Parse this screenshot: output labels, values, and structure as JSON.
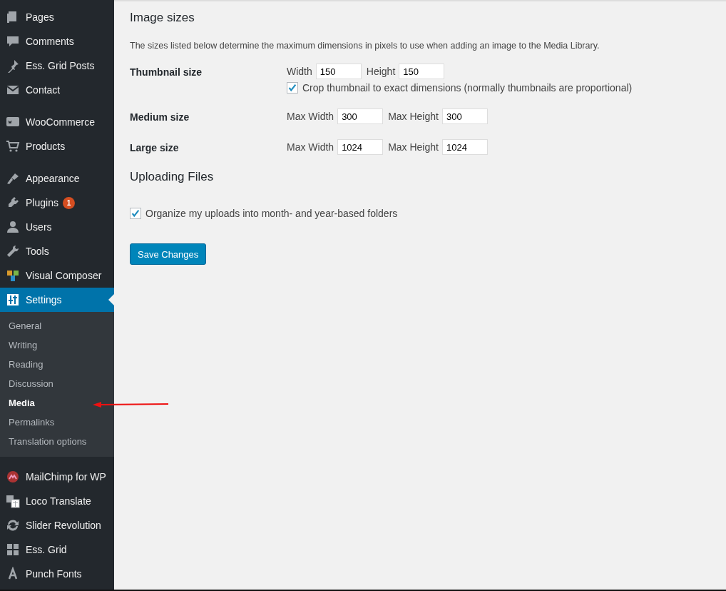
{
  "sidebar": {
    "groups": [
      {
        "items": [
          {
            "label": "Pages",
            "selected": false
          },
          {
            "label": "Comments",
            "selected": false
          },
          {
            "label": "Ess. Grid Posts",
            "selected": false
          },
          {
            "label": "Contact",
            "selected": false
          }
        ]
      },
      {
        "items": [
          {
            "label": "WooCommerce",
            "selected": false
          },
          {
            "label": "Products",
            "selected": false
          }
        ]
      },
      {
        "items": [
          {
            "label": "Appearance",
            "selected": false
          },
          {
            "label": "Plugins",
            "selected": false,
            "badge": "1"
          },
          {
            "label": "Users",
            "selected": false
          },
          {
            "label": "Tools",
            "selected": false
          },
          {
            "label": "Visual Composer",
            "selected": false
          },
          {
            "label": "Settings",
            "selected": true,
            "submenu": [
              {
                "label": "General",
                "selected": false
              },
              {
                "label": "Writing",
                "selected": false
              },
              {
                "label": "Reading",
                "selected": false
              },
              {
                "label": "Discussion",
                "selected": false
              },
              {
                "label": "Media",
                "selected": true
              },
              {
                "label": "Permalinks",
                "selected": false
              },
              {
                "label": "Translation options",
                "selected": false
              }
            ]
          }
        ]
      },
      {
        "items": [
          {
            "label": "MailChimp for WP",
            "selected": false
          },
          {
            "label": "Loco Translate",
            "selected": false
          },
          {
            "label": "Slider Revolution",
            "selected": false
          },
          {
            "label": "Ess. Grid",
            "selected": false
          },
          {
            "label": "Punch Fonts",
            "selected": false
          }
        ]
      }
    ]
  },
  "sections": [
    {
      "title": "Image sizes",
      "description": "The sizes listed below determine the maximum dimensions in pixels to use when adding an image to the Media Library.",
      "rows": [
        {
          "label": "Thumbnail size",
          "fields": [
            {
              "label": "Width",
              "value": "150"
            },
            {
              "label": "Height",
              "value": "150"
            }
          ],
          "checkbox": {
            "label": "Crop thumbnail to exact dimensions (normally thumbnails are proportional)",
            "checked": true
          }
        },
        {
          "label": "Medium size",
          "fields": [
            {
              "label": "Max Width",
              "value": "300"
            },
            {
              "label": "Max Height",
              "value": "300"
            }
          ]
        },
        {
          "label": "Large size",
          "fields": [
            {
              "label": "Max Width",
              "value": "1024"
            },
            {
              "label": "Max Height",
              "value": "1024"
            }
          ]
        }
      ]
    },
    {
      "title": "Uploading Files",
      "checkbox": {
        "label": "Organize my uploads into month- and year-based folders",
        "checked": true
      }
    }
  ],
  "save_button": "Save Changes"
}
